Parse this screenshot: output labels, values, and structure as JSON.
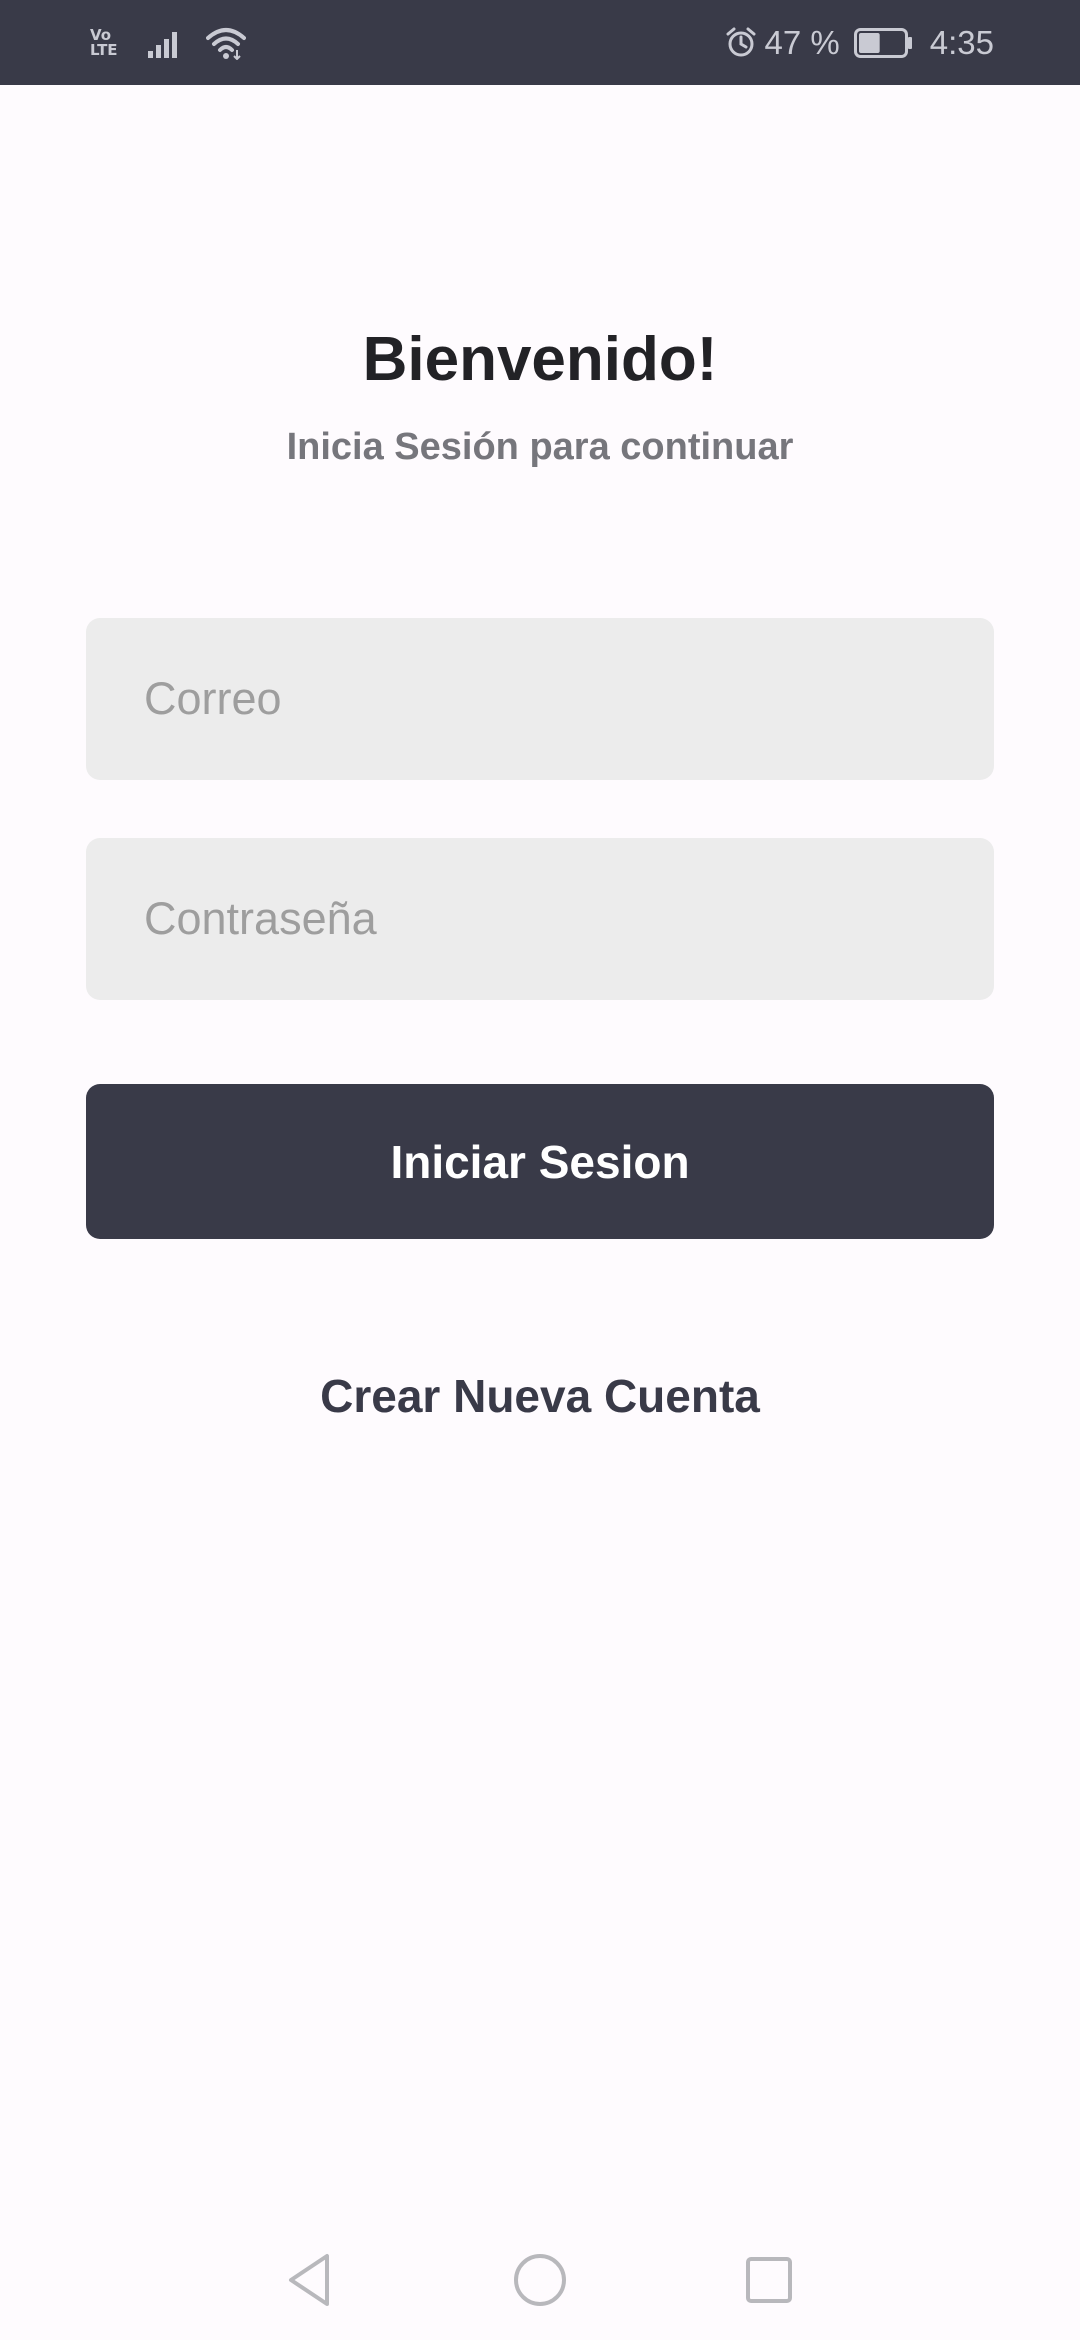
{
  "status_bar": {
    "network_top": "Vo",
    "network_bottom": "LTE",
    "battery_percent": "47 %",
    "time": "4:35",
    "battery_level": 0.47,
    "icons": [
      "volte-icon",
      "signal-icon",
      "wifi-icon",
      "alarm-icon",
      "battery-icon"
    ]
  },
  "login": {
    "title": "Bienvenido!",
    "subtitle": "Inicia Sesión para continuar",
    "email_placeholder": "Correo",
    "password_placeholder": "Contraseña",
    "submit_label": "Iniciar Sesion",
    "create_account_label": "Crear Nueva Cuenta"
  },
  "nav_bar": {
    "icons": [
      "back-icon",
      "home-icon",
      "recents-icon"
    ]
  },
  "colors": {
    "accent": "#393a48",
    "background": "#fefbfe",
    "field_background": "#ececec",
    "title_text": "#222226",
    "subtitle_text": "#76767c"
  }
}
